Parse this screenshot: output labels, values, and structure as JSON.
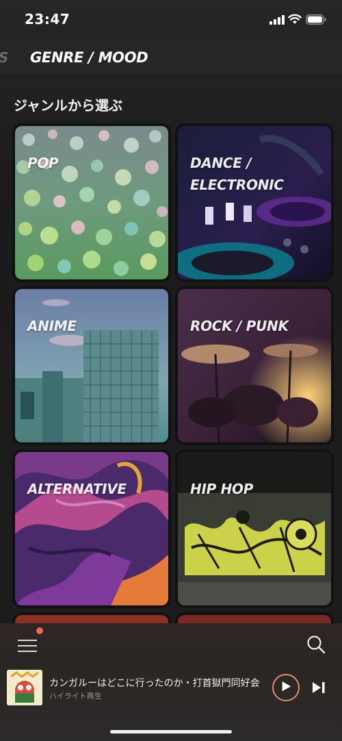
{
  "status": {
    "time": "23:47"
  },
  "tabs": {
    "previous_partial": "S",
    "active": "GENRE / MOOD"
  },
  "section": {
    "title": "ジャンルから選ぶ"
  },
  "genres": [
    {
      "label": "POP",
      "icon": "pop-bokeh"
    },
    {
      "label": "DANCE /\nELECTRONIC",
      "icon": "dance-turntable"
    },
    {
      "label": "ANIME",
      "icon": "anime-city"
    },
    {
      "label": "ROCK / PUNK",
      "icon": "rock-drums"
    },
    {
      "label": "ALTERNATIVE",
      "icon": "alternative-paint"
    },
    {
      "label": "HIP HOP",
      "icon": "hiphop-graffiti"
    }
  ],
  "bottom_nav": {
    "menu_icon": "hamburger-icon",
    "search_icon": "search-icon",
    "badge_color": "#ea6a52"
  },
  "now_playing": {
    "title": "カンガルーはどこに行ったのか・打首獄門同好会",
    "subtitle": "ハイライト再生",
    "accent": "#e78b73"
  }
}
